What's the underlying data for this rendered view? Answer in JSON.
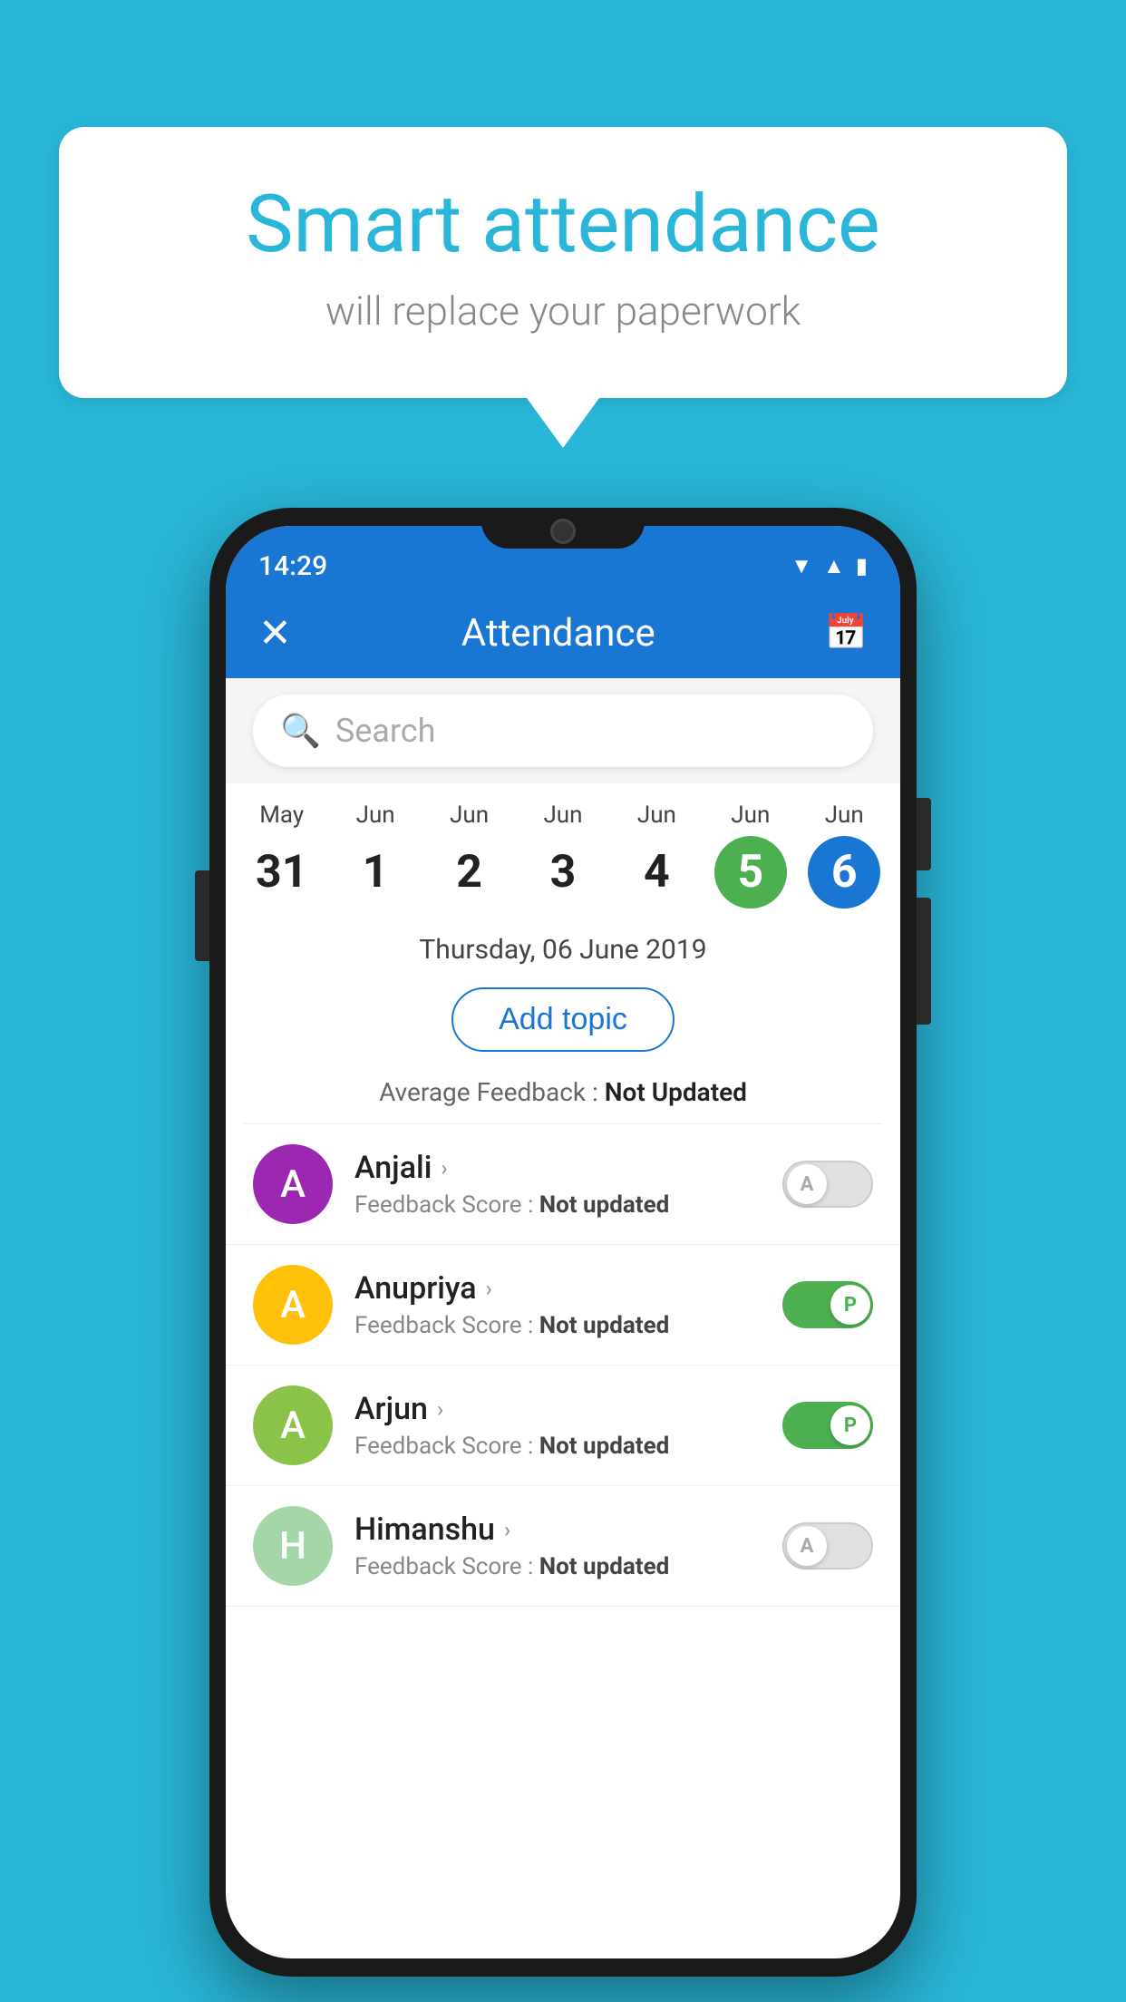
{
  "background_color": "#29b6d8",
  "speech_bubble": {
    "title": "Smart attendance",
    "subtitle": "will replace your paperwork"
  },
  "status_bar": {
    "time": "14:29",
    "icons": [
      "wifi",
      "signal",
      "battery"
    ]
  },
  "header": {
    "close_label": "×",
    "title": "Attendance",
    "calendar_icon": "📅"
  },
  "search": {
    "placeholder": "Search"
  },
  "calendar": {
    "days": [
      {
        "month": "May",
        "date": "31",
        "state": "normal"
      },
      {
        "month": "Jun",
        "date": "1",
        "state": "normal"
      },
      {
        "month": "Jun",
        "date": "2",
        "state": "normal"
      },
      {
        "month": "Jun",
        "date": "3",
        "state": "normal"
      },
      {
        "month": "Jun",
        "date": "4",
        "state": "normal"
      },
      {
        "month": "Jun",
        "date": "5",
        "state": "today"
      },
      {
        "month": "Jun",
        "date": "6",
        "state": "selected"
      }
    ]
  },
  "selected_date_label": "Thursday, 06 June 2019",
  "add_topic_label": "Add topic",
  "avg_feedback_label": "Average Feedback :",
  "avg_feedback_value": "Not Updated",
  "students": [
    {
      "name": "Anjali",
      "avatar_letter": "A",
      "avatar_color": "#9c27b0",
      "feedback_label": "Feedback Score :",
      "feedback_value": "Not updated",
      "toggle_state": "off",
      "toggle_label": "A"
    },
    {
      "name": "Anupriya",
      "avatar_letter": "A",
      "avatar_color": "#ffc107",
      "feedback_label": "Feedback Score :",
      "feedback_value": "Not updated",
      "toggle_state": "on",
      "toggle_label": "P"
    },
    {
      "name": "Arjun",
      "avatar_letter": "A",
      "avatar_color": "#8bc34a",
      "feedback_label": "Feedback Score :",
      "feedback_value": "Not updated",
      "toggle_state": "on",
      "toggle_label": "P"
    },
    {
      "name": "Himanshu",
      "avatar_letter": "H",
      "avatar_color": "#a5d6a7",
      "feedback_label": "Feedback Score :",
      "feedback_value": "Not updated",
      "toggle_state": "off",
      "toggle_label": "A"
    }
  ]
}
